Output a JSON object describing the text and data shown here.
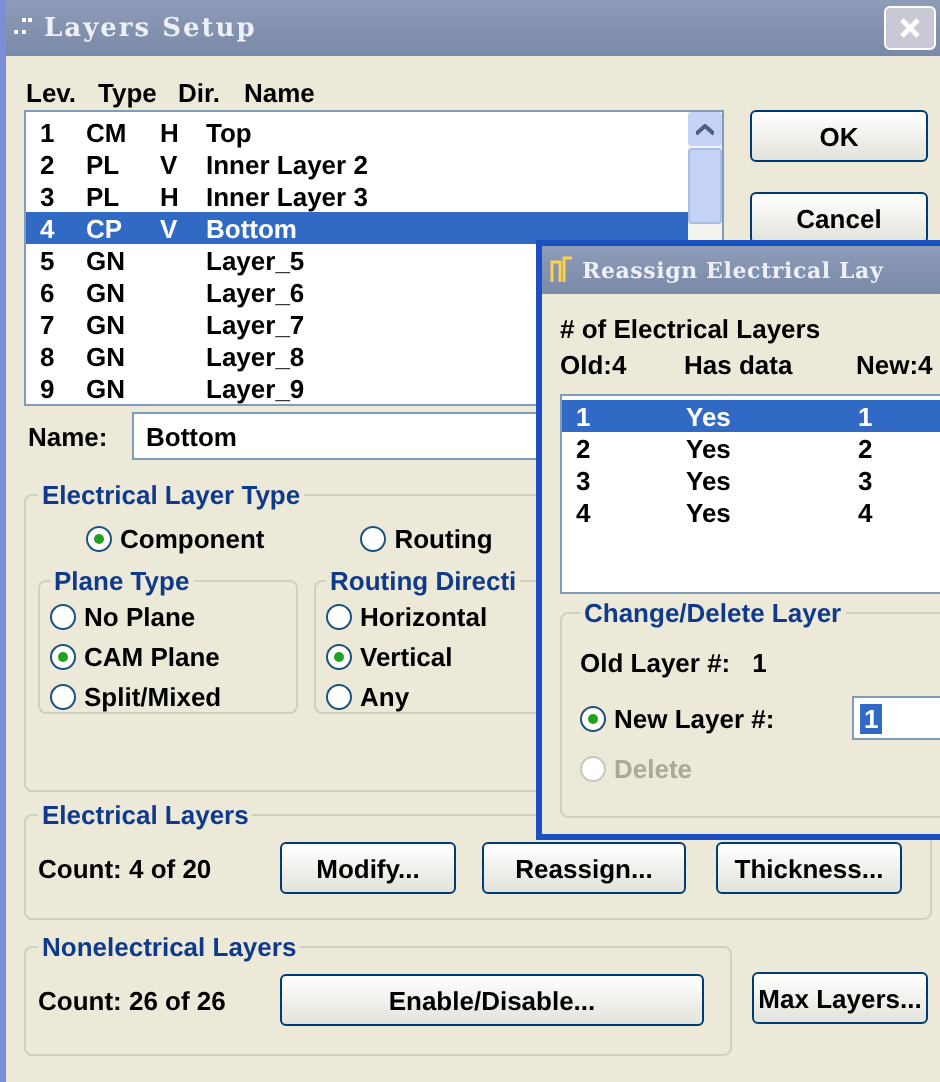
{
  "window": {
    "title": "Layers Setup"
  },
  "list_header": {
    "lev": "Lev.",
    "type": "Type",
    "dir": "Dir.",
    "name": "Name"
  },
  "layers": [
    {
      "lev": "1",
      "type": "CM",
      "dir": "H",
      "name": "Top",
      "selected": false
    },
    {
      "lev": "2",
      "type": "PL",
      "dir": "V",
      "name": "Inner Layer 2",
      "selected": false
    },
    {
      "lev": "3",
      "type": "PL",
      "dir": "H",
      "name": "Inner Layer 3",
      "selected": false
    },
    {
      "lev": "4",
      "type": "CP",
      "dir": "V",
      "name": "Bottom",
      "selected": true
    },
    {
      "lev": "5",
      "type": "GN",
      "name": "Layer_5",
      "selected": false
    },
    {
      "lev": "6",
      "type": "GN",
      "name": "Layer_6",
      "selected": false
    },
    {
      "lev": "7",
      "type": "GN",
      "name": "Layer_7",
      "selected": false
    },
    {
      "lev": "8",
      "type": "GN",
      "name": "Layer_8",
      "selected": false
    },
    {
      "lev": "9",
      "type": "GN",
      "name": "Layer_9",
      "selected": false
    }
  ],
  "buttons": {
    "ok": "OK",
    "cancel": "Cancel"
  },
  "name_field": {
    "label": "Name:",
    "value": "Bottom"
  },
  "electrical_layer_type": {
    "title": "Electrical  Layer Type",
    "options": [
      {
        "label": "Component",
        "checked": true
      },
      {
        "label": "Routing",
        "checked": false
      }
    ]
  },
  "plane_type": {
    "title": "Plane Type",
    "options": [
      {
        "label": "No Plane",
        "checked": false
      },
      {
        "label": "CAM Plane",
        "checked": true
      },
      {
        "label": "Split/Mixed",
        "checked": false
      }
    ]
  },
  "routing_direction": {
    "title": "Routing Directi",
    "options": [
      {
        "label": "Horizontal",
        "checked": false
      },
      {
        "label": "Vertical",
        "checked": true
      },
      {
        "label": "Any",
        "checked": false
      }
    ]
  },
  "electrical_layers": {
    "title": "Electrical Layers",
    "count": "Count:  4 of 20",
    "buttons": [
      "Modify...",
      "Reassign...",
      "Thickness..."
    ]
  },
  "nonelectrical_layers": {
    "title": "Nonelectrical Layers",
    "count": "Count: 26 of 26",
    "buttons": [
      "Enable/Disable..."
    ]
  },
  "max_layers_button": "Max Layers...",
  "reassign_dialog": {
    "title": "Reassign Electrical Lay",
    "heading": "# of Electrical Layers",
    "columns": [
      "Old:4",
      "Has data",
      "New:4"
    ],
    "rows": [
      {
        "old": "1",
        "has_data": "Yes",
        "new": "1",
        "selected": true
      },
      {
        "old": "2",
        "has_data": "Yes",
        "new": "2",
        "selected": false
      },
      {
        "old": "3",
        "has_data": "Yes",
        "new": "3",
        "selected": false
      },
      {
        "old": "4",
        "has_data": "Yes",
        "new": "4",
        "selected": false
      }
    ],
    "group_title": "Change/Delete Layer",
    "old_layer_label": "Old Layer #:",
    "old_layer_value": "1",
    "options": [
      {
        "label": "New Layer #:",
        "checked": true,
        "disabled": false,
        "value": "1"
      },
      {
        "label": "Delete",
        "checked": false,
        "disabled": true
      }
    ]
  }
}
